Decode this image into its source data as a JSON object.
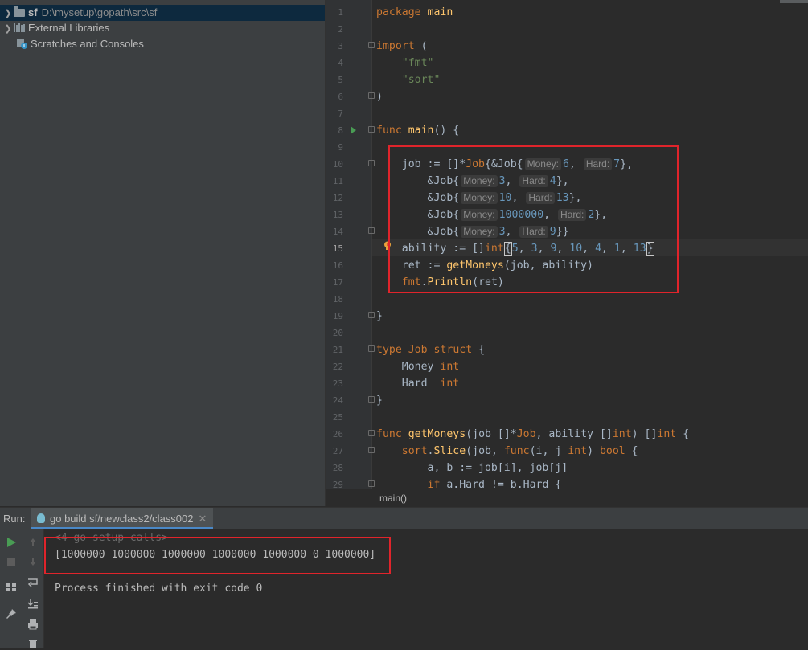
{
  "project": {
    "root_name": "sf",
    "root_path": "D:\\mysetup\\gopath\\src\\sf",
    "items": [
      "External Libraries",
      "Scratches and Consoles"
    ]
  },
  "editor": {
    "line_numbers": [
      "1",
      "2",
      "3",
      "4",
      "5",
      "6",
      "7",
      "8",
      "9",
      "10",
      "11",
      "12",
      "13",
      "14",
      "15",
      "16",
      "17",
      "18",
      "19",
      "20",
      "21",
      "22",
      "23",
      "24",
      "25",
      "26",
      "27",
      "28",
      "29"
    ],
    "breadcrumb": "main()"
  },
  "hints": {
    "money": "Money:",
    "hard": "Hard:"
  },
  "run": {
    "label": "Run:",
    "tab": "go build sf/newclass2/class002",
    "output": [
      "<4 go setup calls>",
      "[1000000 1000000 1000000 1000000 1000000 0 1000000]",
      "",
      "Process finished with exit code 0"
    ]
  },
  "colors": {
    "highlight_box": "#e0242b",
    "keyword": "#cc7832",
    "string": "#6a8759",
    "number": "#6897bb",
    "function": "#ffc66d"
  }
}
